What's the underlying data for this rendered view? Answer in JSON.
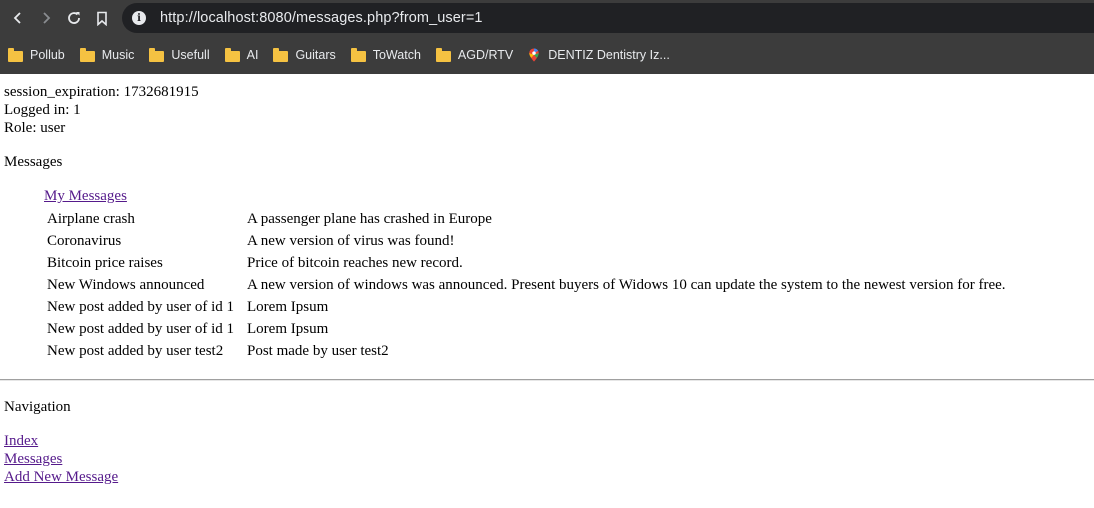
{
  "browser": {
    "url": "http://localhost:8080/messages.php?from_user=1",
    "bookmarks": [
      {
        "label": "Pollub",
        "icon": "folder-icon"
      },
      {
        "label": "Music",
        "icon": "folder-icon"
      },
      {
        "label": "Usefull",
        "icon": "folder-icon"
      },
      {
        "label": "AI",
        "icon": "folder-icon"
      },
      {
        "label": "Guitars",
        "icon": "folder-icon"
      },
      {
        "label": "ToWatch",
        "icon": "folder-icon"
      },
      {
        "label": "AGD/RTV",
        "icon": "folder-icon"
      },
      {
        "label": "DENTIZ Dentistry Iz...",
        "icon": "google-maps-icon"
      }
    ]
  },
  "session": {
    "expiration": "session_expiration: 1732681915",
    "logged_in": "Logged in: 1",
    "role": "Role: user"
  },
  "messages": {
    "heading": "Messages",
    "my_messages_link": "My Messages",
    "rows": [
      {
        "title": "Airplane crash",
        "body": "A passenger plane has crashed in Europe"
      },
      {
        "title": "Coronavirus",
        "body": "A new version of virus was found!"
      },
      {
        "title": "Bitcoin price raises",
        "body": "Price of bitcoin reaches new record."
      },
      {
        "title": "New Windows announced",
        "body": "A new version of windows was announced. Present buyers of Widows 10 can update the system to the newest version for free."
      },
      {
        "title": "New post added by user of id 1",
        "body": "Lorem Ipsum"
      },
      {
        "title": "New post added by user of id 1",
        "body": "Lorem Ipsum"
      },
      {
        "title": "New post added by user test2",
        "body": "Post made by user test2"
      }
    ]
  },
  "navigation": {
    "heading": "Navigation",
    "links": [
      "Index",
      "Messages",
      "Add New Message"
    ]
  }
}
